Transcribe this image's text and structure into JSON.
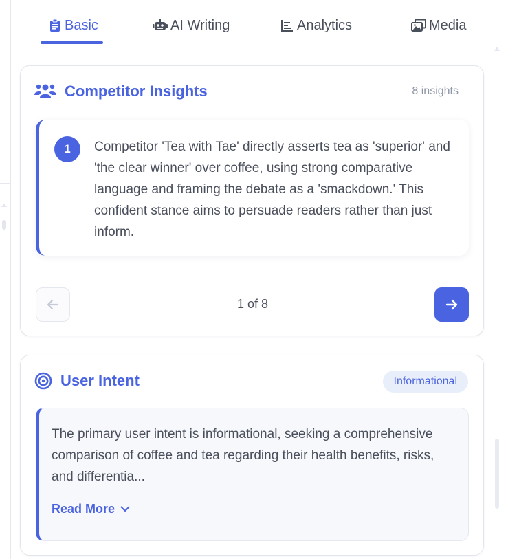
{
  "tabs": [
    {
      "label": "Basic",
      "icon": "clipboard-icon",
      "active": true
    },
    {
      "label": "AI Writing",
      "icon": "robot-icon",
      "active": false
    },
    {
      "label": "Analytics",
      "icon": "bar-chart-icon",
      "active": false
    },
    {
      "label": "Media",
      "icon": "images-icon",
      "active": false
    }
  ],
  "competitor": {
    "title": "Competitor Insights",
    "count_label": "8 insights",
    "insight_number": "1",
    "insight_text": "Competitor 'Tea with Tae' directly asserts tea as 'superior' and 'the clear winner' over coffee, using strong comparative language and framing the debate as a 'smackdown.' This confident stance aims to persuade readers rather than just inform.",
    "pager": "1 of 8"
  },
  "intent": {
    "title": "User Intent",
    "badge": "Informational",
    "text": "The primary user intent is informational, seeking a comprehensive comparison of coffee and tea regarding their health benefits, risks, and differentia...",
    "read_more": "Read More"
  },
  "colors": {
    "accent": "#4a63e0",
    "muted_text": "#8e95a6",
    "badge_bg": "#e9eefb"
  }
}
